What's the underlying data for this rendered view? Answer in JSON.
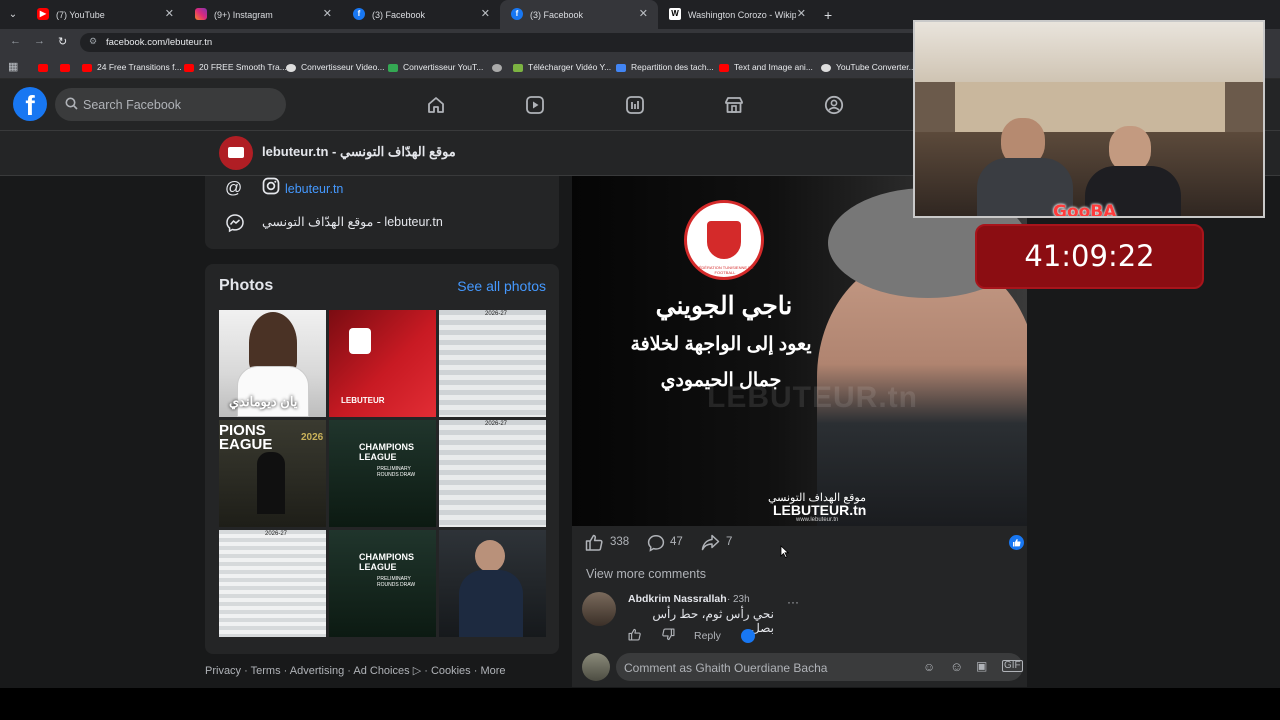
{
  "browser": {
    "tabs": [
      {
        "title": "(7) YouTube",
        "icon": "youtube-icon",
        "color": "#ff0000"
      },
      {
        "title": "(9+) Instagram",
        "icon": "instagram-icon",
        "color": "#e1306c"
      },
      {
        "title": "(3) Facebook",
        "icon": "facebook-icon",
        "color": "#1877f2"
      },
      {
        "title": "(3) Facebook",
        "icon": "facebook-icon",
        "color": "#1877f2",
        "active": true
      },
      {
        "title": "Washington Corozo - Wikipedia",
        "icon": "wikipedia-icon",
        "color": "#ffffff"
      }
    ],
    "new_tab": "+",
    "url": "facebook.com/lebuteur.tn",
    "bookmarks": [
      {
        "label": "",
        "color": "#ff0000"
      },
      {
        "label": "",
        "color": "#ff0000"
      },
      {
        "label": "24 Free Transitions f...",
        "color": "#ff0000"
      },
      {
        "label": "20 FREE Smooth Tra...",
        "color": "#ff0000"
      },
      {
        "label": "Convertisseur Video...",
        "color": "#dddddd"
      },
      {
        "label": "Convertisseur YouT...",
        "color": "#34a853"
      },
      {
        "label": "",
        "color": "#aaaaaa"
      },
      {
        "label": "Télécharger Vidéo Y...",
        "color": "#7cb342"
      },
      {
        "label": "Repartition des tach...",
        "color": "#4285f4"
      },
      {
        "label": "Text and Image ani...",
        "color": "#ff0000"
      },
      {
        "label": "YouTube Converter...",
        "color": "#dddddd"
      }
    ]
  },
  "fb": {
    "logo": "f",
    "search_placeholder": "Search Facebook",
    "nav_icons": [
      "home-icon",
      "video-icon",
      "feeds-icon",
      "marketplace-icon",
      "groups-icon"
    ],
    "brand_color": "#1877f2"
  },
  "page": {
    "name": "lebuteur.tn - موقع الهدّاف التونسي",
    "intro": {
      "instagram_handle": "lebuteur.tn",
      "messenger_label": "موقع الهدّاف التونسي - lebuteur.tn"
    },
    "photos": {
      "title": "Photos",
      "see_all": "See all photos",
      "thumb1_text": "يان ديوماندي",
      "thumb2_text": "LEBUTEUR",
      "thumb4_text": "PIONS EAGUE",
      "thumb4_year": "2026",
      "thumb5_text": "CHAMPIONS LEAGUE",
      "thumb5_sub": "PRELIMINARY ROUNDS DRAW",
      "thumb8_text": "CHAMPIONS LEAGUE",
      "thumb8_sub": "PRELIMINARY ROUNDS DRAW",
      "table_header": "2026-27"
    },
    "footer": [
      "Privacy",
      "Terms",
      "Advertising",
      "Ad Choices",
      "Cookies",
      "More"
    ]
  },
  "post": {
    "image": {
      "headline": "ناجي الجويني",
      "line2": "يعود إلى الواجهة لخلافة",
      "line3": "جمال الحيمودي",
      "brand_ar": "موقع الهداف التونسي",
      "brand_en": "LEBUTEUR.tn",
      "site": "www.lebuteur.tn",
      "watermark": "LEBUTEUR.tn",
      "federation": "FÉDÉRATION TUNISIENNE DE FOOTBALL"
    },
    "likes": "338",
    "comments": "47",
    "shares": "7",
    "view_more": "View more comments",
    "comment": {
      "author": "Abdkrim Nassrallah",
      "time": "23h",
      "text": "نحي رأس ثوم، حط رأس بصل",
      "reply": "Reply",
      "more": "···"
    },
    "composer_placeholder": "Comment as Ghaith Ouerdiane Bacha"
  },
  "overlay": {
    "streamer_name": "GooBA",
    "timer": "41:09:22",
    "timer_color": "#8b0d12"
  }
}
